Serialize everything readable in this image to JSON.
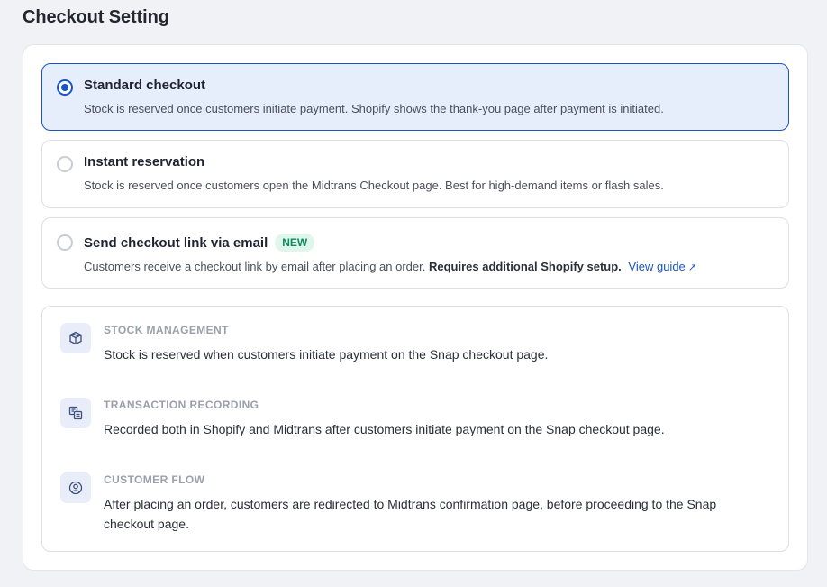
{
  "page": {
    "title": "Checkout Setting"
  },
  "options": [
    {
      "title": "Standard checkout",
      "description": "Stock is reserved once customers initiate payment. Shopify shows the thank-you page after payment is initiated.",
      "selected": true
    },
    {
      "title": "Instant reservation",
      "description": "Stock is reserved once customers open the Midtrans Checkout page. Best for high-demand items or flash sales.",
      "selected": false
    },
    {
      "title": "Send checkout link via email",
      "badge": "NEW",
      "description": "Customers receive a checkout link by email after placing an order.",
      "description_bold": "Requires additional Shopify setup.",
      "link_label": "View guide",
      "link_icon": "↗",
      "selected": false
    }
  ],
  "info": [
    {
      "icon": "box-icon",
      "heading": "STOCK MANAGEMENT",
      "text": "Stock is reserved when customers initiate payment on the Snap checkout page."
    },
    {
      "icon": "transaction-icon",
      "heading": "TRANSACTION RECORDING",
      "text": "Recorded both in Shopify and Midtrans after customers initiate payment on the Snap checkout page."
    },
    {
      "icon": "user-circle-icon",
      "heading": "CUSTOMER FLOW",
      "text": "After placing an order, customers are redirected to Midtrans confirmation page, before proceeding to the Snap checkout page."
    }
  ],
  "colors": {
    "accent": "#1b55c4",
    "selected_bg": "#e6eefc",
    "badge_bg": "#dff6ec",
    "badge_text": "#0e8a5f"
  }
}
